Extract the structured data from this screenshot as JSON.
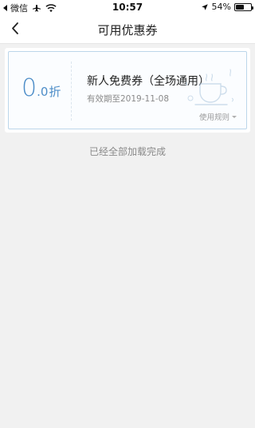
{
  "status_bar": {
    "back_app": "微信",
    "time": "10:57",
    "battery_text": "54%",
    "battery_level": 0.54
  },
  "nav": {
    "title": "可用优惠券"
  },
  "coupon": {
    "value_int": "0",
    "value_dec": ".0",
    "value_unit": "折",
    "title": "新人免费券（全场通用）",
    "expiry": "有效期至2019-11-08",
    "rules_label": "使用规则",
    "accent_color": "#4d8dc8",
    "border_color": "#bcd6ea"
  },
  "list": {
    "end_text": "已经全部加载完成"
  }
}
